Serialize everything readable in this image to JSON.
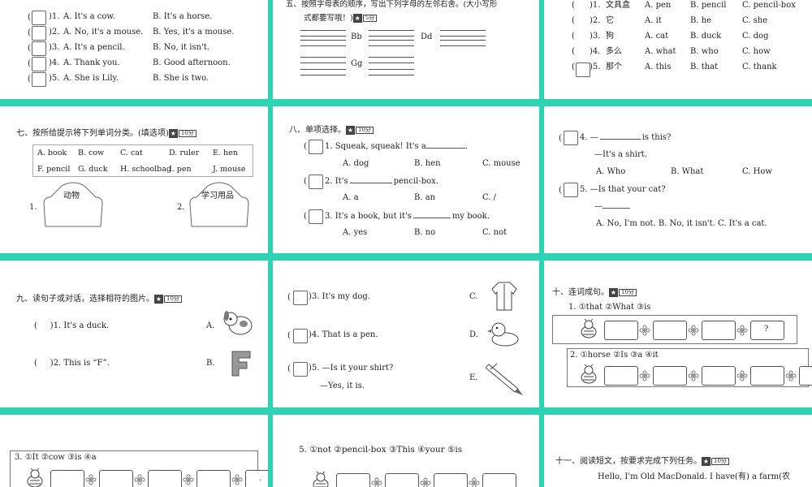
{
  "s1": {
    "rows": [
      {
        "num": "1",
        "a": "A. It's a cow.",
        "b": "B. It's a horse."
      },
      {
        "num": "2",
        "a": "A. No, it's a mouse.",
        "b": "B. Yes, it's a mouse."
      },
      {
        "num": "3",
        "a": "A. It's a pencil.",
        "b": "B. No, it isn't."
      },
      {
        "num": "4",
        "a": "A. Thank you.",
        "b": "B. Good afternoon."
      },
      {
        "num": "5",
        "a": "A. She is Lily.",
        "b": "B. She is two."
      }
    ]
  },
  "s2": {
    "title1": "五、按照字母表的顺序，写出下列字母的左邻右舍。(大小写形",
    "title2": "式都要写哦！)",
    "score": "5分",
    "letters": [
      "Bb",
      "Dd",
      "Gg"
    ]
  },
  "s3": {
    "rows": [
      {
        "num": "1",
        "zh": "文具盒",
        "a": "A. pen",
        "b": "B. pencil",
        "c": "C. pencil-box"
      },
      {
        "num": "2",
        "zh": "它",
        "a": "A. it",
        "b": "B. he",
        "c": "C. she"
      },
      {
        "num": "3",
        "zh": "狗",
        "a": "A. cat",
        "b": "B. duck",
        "c": "C. dog"
      },
      {
        "num": "4",
        "zh": "多么",
        "a": "A. what",
        "b": "B. who",
        "c": "C. how"
      },
      {
        "num": "5",
        "zh": "那个",
        "a": "A. this",
        "b": "B. that",
        "c": "C. thank"
      }
    ]
  },
  "s4": {
    "title": "七、按所给提示将下列单词分类。(填选项)",
    "score": "10分",
    "words_row1": [
      "A. book",
      "B. cow",
      "C. cat",
      "D. ruler",
      "E. hen"
    ],
    "words_row2": [
      "F. pencil",
      "G. duck",
      "H. schoolbag",
      "I. pen",
      "J. mouse"
    ],
    "house1_num": "1.",
    "house1_label": "动物",
    "house2_num": "2.",
    "house2_label": "学习用品"
  },
  "s5": {
    "title": "八、单项选择。",
    "score": "10分",
    "q1": "1. Squeak, squeak! It's a",
    "q1_opts": [
      "A. dog",
      "B. hen",
      "C. mouse"
    ],
    "q2a": "2. It's",
    "q2b": "pencil-box.",
    "q2_opts": [
      "A. a",
      "B. an",
      "C. /"
    ],
    "q3a": "3. It's a book, but it's",
    "q3b": "my book.",
    "q3_opts": [
      "A. yes",
      "B. no",
      "C. not"
    ]
  },
  "s6": {
    "q4a": "4. —",
    "q4b": "is this?",
    "q4_reply": "—It's a shirt.",
    "q4_opts": [
      "A. Who",
      "B. What",
      "C. How"
    ],
    "q5": "5. —Is that your cat?",
    "q5_reply": "—",
    "q5_opts": "A. No, I'm not. B. No, it isn't. C. It's a cat."
  },
  "s7": {
    "title": "九、读句子或对话，选择相符的图片。",
    "score": "10分",
    "q1": ")1. It's a duck.",
    "q2": ")2. This is “F”.",
    "labA": "A.",
    "labB": "B."
  },
  "s8": {
    "q3": ")3. It's my dog.",
    "q4": ")4. That is a pen.",
    "q5": ")5. —Is it your shirt?",
    "q5r": "—Yes, it is.",
    "labC": "C.",
    "labD": "D.",
    "labE": "E."
  },
  "s9": {
    "title": "十、连词成句。",
    "score": "10分",
    "row1": "1. ①that   ②What   ③is",
    "row2": "2. ①horse   ②Is   ③a   ④it",
    "qmark": "?"
  },
  "s10": {
    "row": "3. ①It   ②cow   ③is   ④a",
    "dot": "."
  },
  "s11": {
    "row": "5. ①not   ②pencil-box   ③This   ④your   ⑤is"
  },
  "s12": {
    "title": "十一、阅读短文，按要求完成下列任务。",
    "score": "10分",
    "text": "Hello, I'm Old MacDonald. I have(有) a farm(农"
  },
  "colors": {
    "background": "#2ed3b4",
    "slide": "#ffffff"
  }
}
